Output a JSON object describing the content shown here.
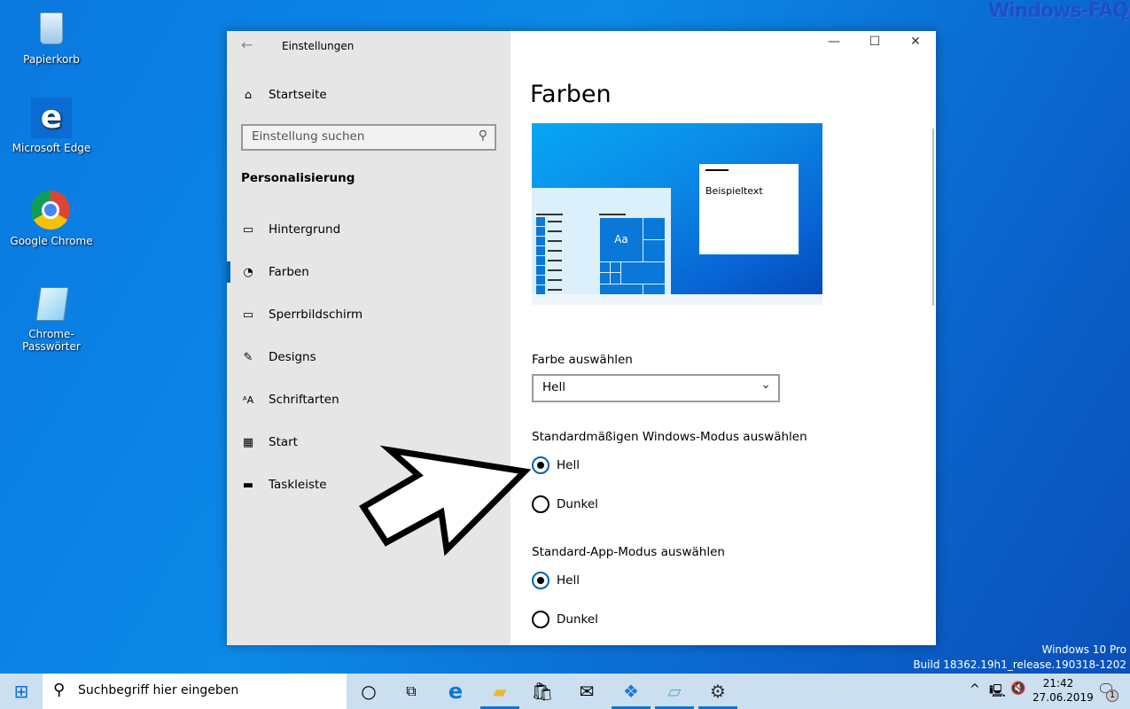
{
  "watermark": "Windows-FAQ",
  "desktop": {
    "icons": [
      {
        "label": "Papierkorb",
        "icon": "recycle-bin-icon"
      },
      {
        "label": "Microsoft Edge",
        "icon": "edge-icon"
      },
      {
        "label": "Google Chrome",
        "icon": "chrome-icon"
      },
      {
        "label": "Chrome-Passwörter",
        "icon": "notepad-icon"
      }
    ]
  },
  "window": {
    "title": "Einstellungen",
    "sidebar": {
      "home": "Startseite",
      "search_placeholder": "Einstellung suchen",
      "category": "Personalisierung",
      "items": [
        {
          "label": "Hintergrund",
          "icon": "image-icon"
        },
        {
          "label": "Farben",
          "icon": "palette-icon",
          "selected": true
        },
        {
          "label": "Sperrbildschirm",
          "icon": "lockscreen-icon"
        },
        {
          "label": "Designs",
          "icon": "designs-icon"
        },
        {
          "label": "Schriftarten",
          "icon": "font-icon"
        },
        {
          "label": "Start",
          "icon": "start-icon"
        },
        {
          "label": "Taskleiste",
          "icon": "taskbar-icon"
        }
      ]
    },
    "content": {
      "title": "Farben",
      "preview": {
        "sample_text": "Beispieltext",
        "tile_text": "Aa"
      },
      "color_label": "Farbe auswählen",
      "color_value": "Hell",
      "windows_mode": {
        "label": "Standardmäßigen Windows-Modus auswählen",
        "options": [
          "Hell",
          "Dunkel"
        ],
        "selected": "Hell"
      },
      "app_mode": {
        "label": "Standard-App-Modus auswählen",
        "options": [
          "Hell",
          "Dunkel"
        ],
        "selected": "Hell"
      }
    }
  },
  "build": {
    "line1": "Windows 10 Pro",
    "line2": "Build 18362.19h1_release.190318-1202"
  },
  "taskbar": {
    "search_placeholder": "Suchbegriff hier eingeben",
    "time": "21:42",
    "date": "27.06.2019",
    "notifications": "1",
    "accent": "#0078d7"
  }
}
